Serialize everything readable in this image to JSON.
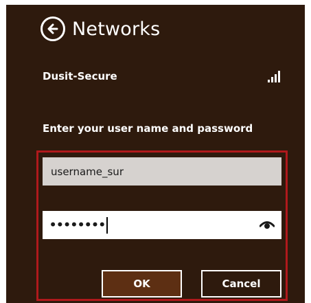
{
  "header": {
    "title": "Networks",
    "back_icon": "back-arrow-circle-icon"
  },
  "network": {
    "name": "Dusit-Secure",
    "signal_icon": "signal-strength-icon",
    "signal_bars": 4
  },
  "auth": {
    "prompt": "Enter your user name and password",
    "username_value": "username_sur",
    "password_value": "••••••••",
    "reveal_icon": "show-password-eye-icon"
  },
  "buttons": {
    "ok_label": "OK",
    "cancel_label": "Cancel"
  },
  "colors": {
    "panel_background": "#2e1a0d",
    "ok_button_background": "#5d2f13",
    "highlight_border": "#b0191c",
    "username_field_background": "#d6d2cf"
  }
}
